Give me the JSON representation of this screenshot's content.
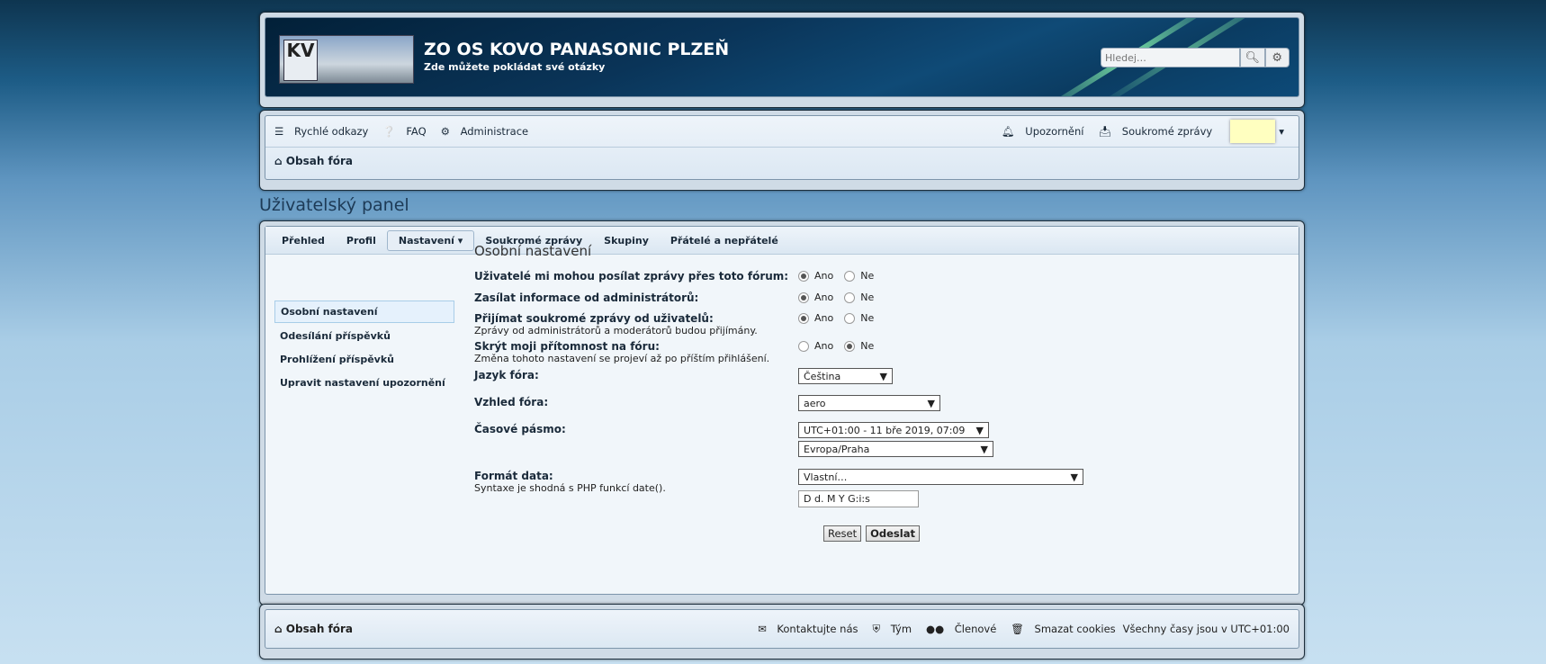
{
  "header": {
    "title": "ZO OS KOVO PANASONIC PLZEŇ",
    "subtitle": "Zde můžete pokládat své otázky",
    "logo_text": "KV",
    "search_placeholder": "Hledej…"
  },
  "nav": {
    "quick_links": "Rychlé odkazy",
    "faq": "FAQ",
    "admin": "Administrace",
    "notifications": "Upozornění",
    "private_messages": "Soukromé zprávy",
    "breadcrumb": "Obsah fóra"
  },
  "page_title": "Uživatelský panel",
  "tabs": [
    "Přehled",
    "Profil",
    "Nastavení",
    "Soukromé zprávy",
    "Skupiny",
    "Přátelé a nepřátelé"
  ],
  "menu": [
    "Osobní nastavení",
    "Odesílání příspěvků",
    "Prohlížení příspěvků",
    "Upravit nastavení upozornění"
  ],
  "form": {
    "title": "Osobní nastavení",
    "yes": "Ano",
    "no": "Ne",
    "q1": "Uživatelé mi mohou posílat zprávy přes toto fórum:",
    "q2": "Zasílat informace od administrátorů:",
    "q3": "Přijímat soukromé zprávy od uživatelů:",
    "q3_help": "Zprávy od administrátorů a moderátorů budou přijímány.",
    "q4": "Skrýt moji přítomnost na fóru:",
    "q4_help": "Změna tohoto nastavení se projeví až po příštím přihlášení.",
    "lang_label": "Jazyk fóra:",
    "lang_value": "Čeština",
    "style_label": "Vzhled fóra:",
    "style_value": "aero",
    "tz_label": "Časové pásmo:",
    "tz_value": "UTC+01:00 - 11 bře 2019, 07:09",
    "tz_region": "Evropa/Praha",
    "date_label": "Formát data:",
    "date_help": "Syntaxe je shodná s PHP funkcí date().",
    "date_select": "Vlastní…",
    "date_value": "D d. M Y G:i:s",
    "reset": "Reset",
    "submit": "Odeslat"
  },
  "footer": {
    "home": "Obsah fóra",
    "contact": "Kontaktujte nás",
    "team": "Tým",
    "members": "Členové",
    "cookies": "Smazat cookies",
    "timezone": "Všechny časy jsou v UTC+01:00"
  }
}
